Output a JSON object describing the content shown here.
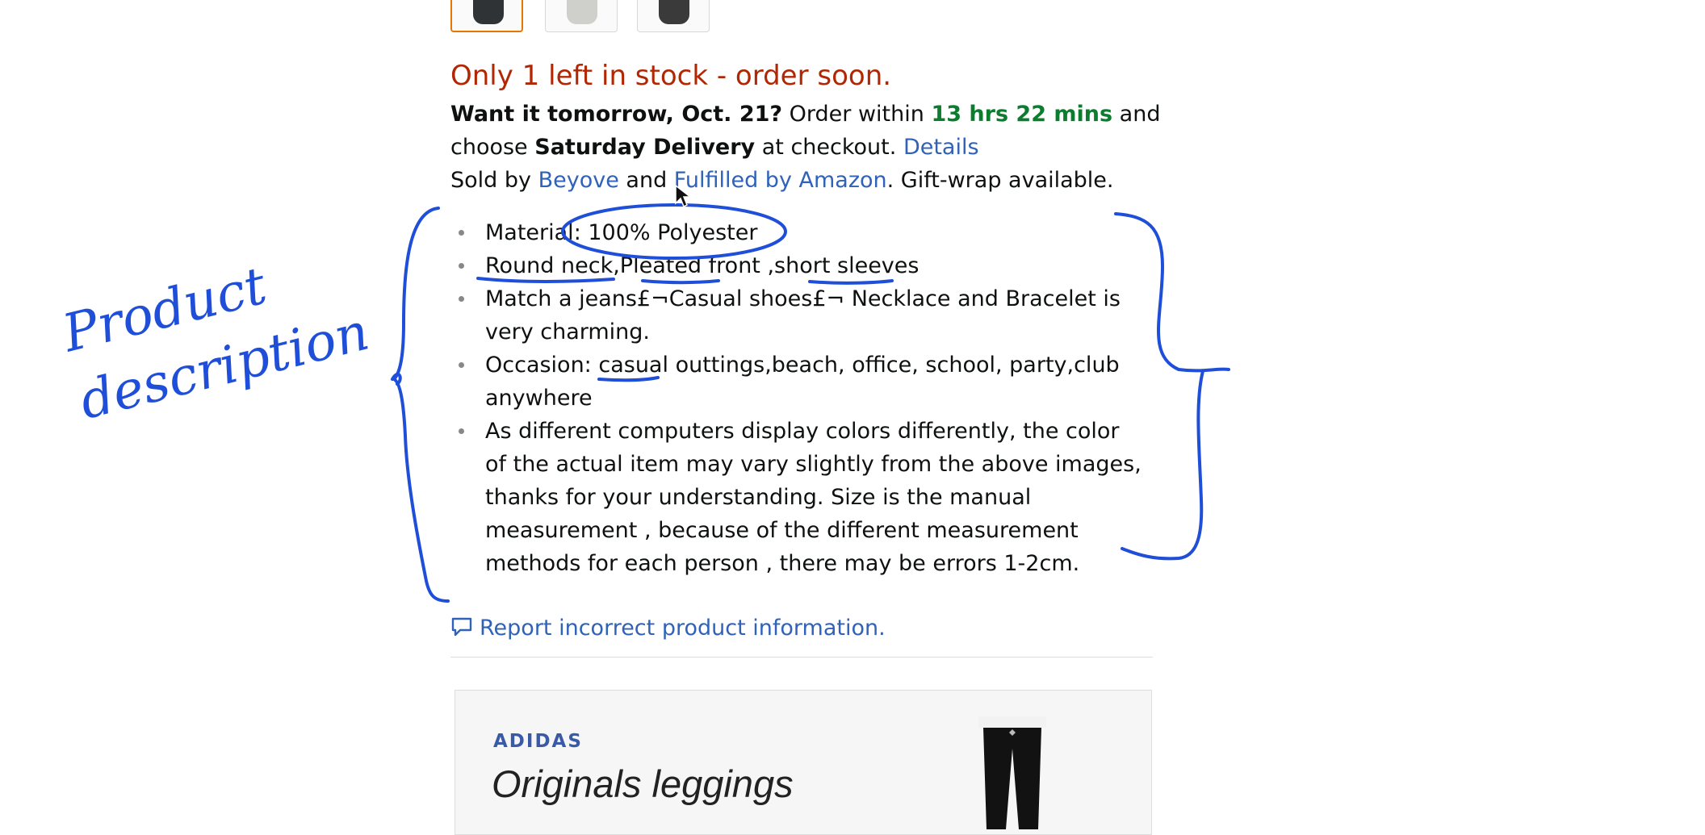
{
  "stock_message": "Only 1 left in stock - order soon.",
  "delivery": {
    "bold_prefix": "Want it tomorrow, Oct. 21?",
    "order_within": " Order within ",
    "time_left": "13 hrs 22 mins",
    "and": " and",
    "choose": "choose ",
    "saturday": "Saturday Delivery",
    "at_checkout": " at checkout. ",
    "details_link": "Details"
  },
  "sold_by": {
    "prefix": "Sold by ",
    "seller_link": "Beyove",
    "and": " and ",
    "fulfilled_link": "Fulfilled by Amazon",
    "suffix": ". Gift-wrap available."
  },
  "bullets": [
    {
      "line1": "Material: 100% Polyester",
      "line2": ""
    },
    {
      "line1": "Round neck,Pleated front ,short sleeves",
      "line2": ""
    },
    {
      "line1": "Match a jeans£¬Casual shoes£¬ Necklace and Bracelet is",
      "line2": "very charming."
    },
    {
      "line1": "Occasion: casual outtings,beach, office, school, party,club",
      "line2": "anywhere"
    },
    {
      "line1": "As different computers display colors differently, the color",
      "line2": "of the actual item may vary slightly from the above images,",
      "line3": "thanks for your understanding. Size is the manual",
      "line4": "measurement , because of the different measurement",
      "line5": "methods for each person , there may be errors 1-2cm."
    }
  ],
  "report_link": "Report incorrect product information.",
  "ad": {
    "brand": "ADIDAS",
    "title": "Originals leggings"
  },
  "annotation": {
    "handwritten": "Product description",
    "ink_color": "#1f4fd8"
  },
  "icons": [
    "comment-icon",
    "mouse-cursor-icon"
  ]
}
